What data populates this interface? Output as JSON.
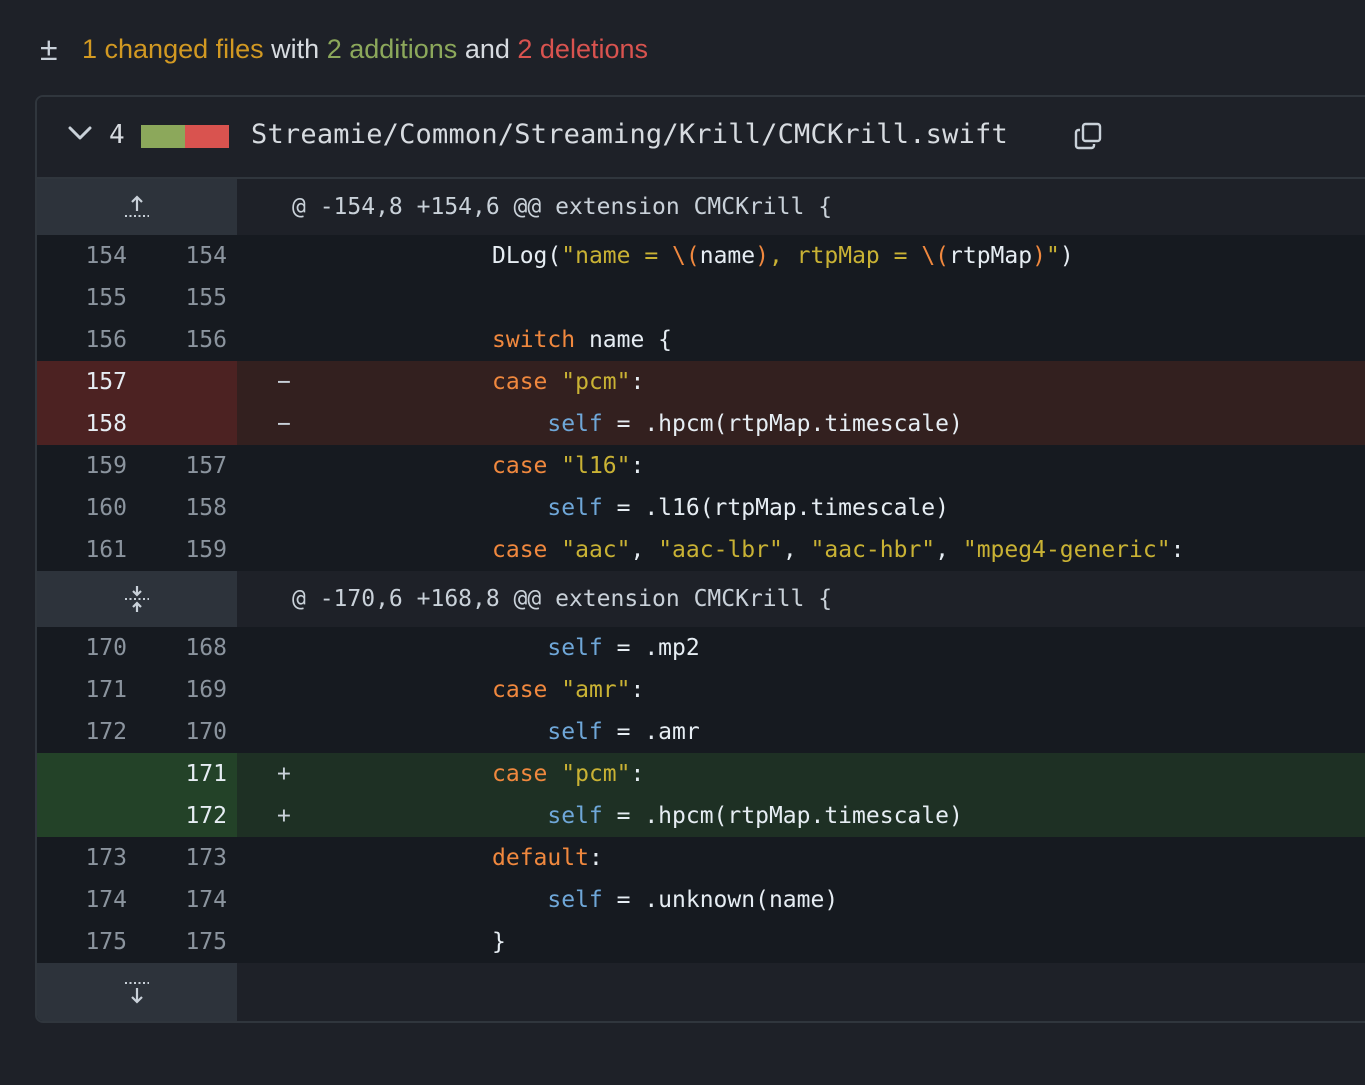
{
  "summary": {
    "icon": "plus-minus-icon",
    "files": "1 changed files",
    "with": "with",
    "additions": "2 additions",
    "and": "and",
    "deletions": "2 deletions"
  },
  "file": {
    "change_count": "4",
    "path": "Streamie/Common/Streaming/Krill/CMCKrill.swift",
    "diffstat_colors": [
      "#8ca85b",
      "#d9534f"
    ]
  },
  "hunks": [
    {
      "header": "@ -154,8 +154,6 @@ extension CMCKrill {",
      "expander": "expand-up-icon"
    },
    {
      "header": "@ -170,6 +168,8 @@ extension CMCKrill {",
      "expander": "expand-both-icon"
    },
    {
      "header": "",
      "expander": "expand-down-icon"
    }
  ],
  "lines": [
    {
      "old": "154",
      "new": "154",
      "sign": "",
      "type": "ctx",
      "code": [
        [
          "pl",
          "DLog("
        ],
        [
          "str",
          "\"name = "
        ],
        [
          "kw",
          "\\("
        ],
        [
          "pl",
          "name"
        ],
        [
          "kw",
          ")"
        ],
        [
          "str",
          ", rtpMap = "
        ],
        [
          "kw",
          "\\("
        ],
        [
          "pl",
          "rtpMap"
        ],
        [
          "kw",
          ")"
        ],
        [
          "str",
          "\""
        ],
        [
          "pl",
          ")"
        ]
      ]
    },
    {
      "old": "155",
      "new": "155",
      "sign": "",
      "type": "ctx",
      "code": []
    },
    {
      "old": "156",
      "new": "156",
      "sign": "",
      "type": "ctx",
      "code": [
        [
          "kw",
          "switch"
        ],
        [
          "pl",
          " name {"
        ]
      ]
    },
    {
      "old": "157",
      "new": "",
      "sign": "−",
      "type": "del",
      "code": [
        [
          "kw",
          "case"
        ],
        [
          "pl",
          " "
        ],
        [
          "str",
          "\"pcm\""
        ],
        [
          "pl",
          ":"
        ]
      ]
    },
    {
      "old": "158",
      "new": "",
      "sign": "−",
      "type": "del",
      "code": [
        [
          "pl",
          "    "
        ],
        [
          "kw2",
          "self"
        ],
        [
          "pl",
          " = .hpcm(rtpMap.timescale)"
        ]
      ]
    },
    {
      "old": "159",
      "new": "157",
      "sign": "",
      "type": "ctx",
      "code": [
        [
          "kw",
          "case"
        ],
        [
          "pl",
          " "
        ],
        [
          "str",
          "\"l16\""
        ],
        [
          "pl",
          ":"
        ]
      ]
    },
    {
      "old": "160",
      "new": "158",
      "sign": "",
      "type": "ctx",
      "code": [
        [
          "pl",
          "    "
        ],
        [
          "kw2",
          "self"
        ],
        [
          "pl",
          " = .l16(rtpMap.timescale)"
        ]
      ]
    },
    {
      "old": "161",
      "new": "159",
      "sign": "",
      "type": "ctx",
      "code": [
        [
          "kw",
          "case"
        ],
        [
          "pl",
          " "
        ],
        [
          "str",
          "\"aac\""
        ],
        [
          "pl",
          ", "
        ],
        [
          "str",
          "\"aac-lbr\""
        ],
        [
          "pl",
          ", "
        ],
        [
          "str",
          "\"aac-hbr\""
        ],
        [
          "pl",
          ", "
        ],
        [
          "str",
          "\"mpeg4-generic\""
        ],
        [
          "pl",
          ":"
        ]
      ]
    },
    {
      "old": "170",
      "new": "168",
      "sign": "",
      "type": "ctx",
      "code": [
        [
          "pl",
          "    "
        ],
        [
          "kw2",
          "self"
        ],
        [
          "pl",
          " = .mp2"
        ]
      ]
    },
    {
      "old": "171",
      "new": "169",
      "sign": "",
      "type": "ctx",
      "code": [
        [
          "kw",
          "case"
        ],
        [
          "pl",
          " "
        ],
        [
          "str",
          "\"amr\""
        ],
        [
          "pl",
          ":"
        ]
      ]
    },
    {
      "old": "172",
      "new": "170",
      "sign": "",
      "type": "ctx",
      "code": [
        [
          "pl",
          "    "
        ],
        [
          "kw2",
          "self"
        ],
        [
          "pl",
          " = .amr"
        ]
      ]
    },
    {
      "old": "",
      "new": "171",
      "sign": "+",
      "type": "add",
      "code": [
        [
          "kw",
          "case"
        ],
        [
          "pl",
          " "
        ],
        [
          "str",
          "\"pcm\""
        ],
        [
          "pl",
          ":"
        ]
      ]
    },
    {
      "old": "",
      "new": "172",
      "sign": "+",
      "type": "add",
      "code": [
        [
          "pl",
          "    "
        ],
        [
          "kw2",
          "self"
        ],
        [
          "pl",
          " = .hpcm(rtpMap.timescale)"
        ]
      ]
    },
    {
      "old": "173",
      "new": "173",
      "sign": "",
      "type": "ctx",
      "code": [
        [
          "kw",
          "default"
        ],
        [
          "pl",
          ":"
        ]
      ]
    },
    {
      "old": "174",
      "new": "174",
      "sign": "",
      "type": "ctx",
      "code": [
        [
          "pl",
          "    "
        ],
        [
          "kw2",
          "self"
        ],
        [
          "pl",
          " = .unknown(name)"
        ]
      ]
    },
    {
      "old": "175",
      "new": "175",
      "sign": "",
      "type": "ctx",
      "code": [
        [
          "pl",
          "}"
        ]
      ]
    }
  ]
}
